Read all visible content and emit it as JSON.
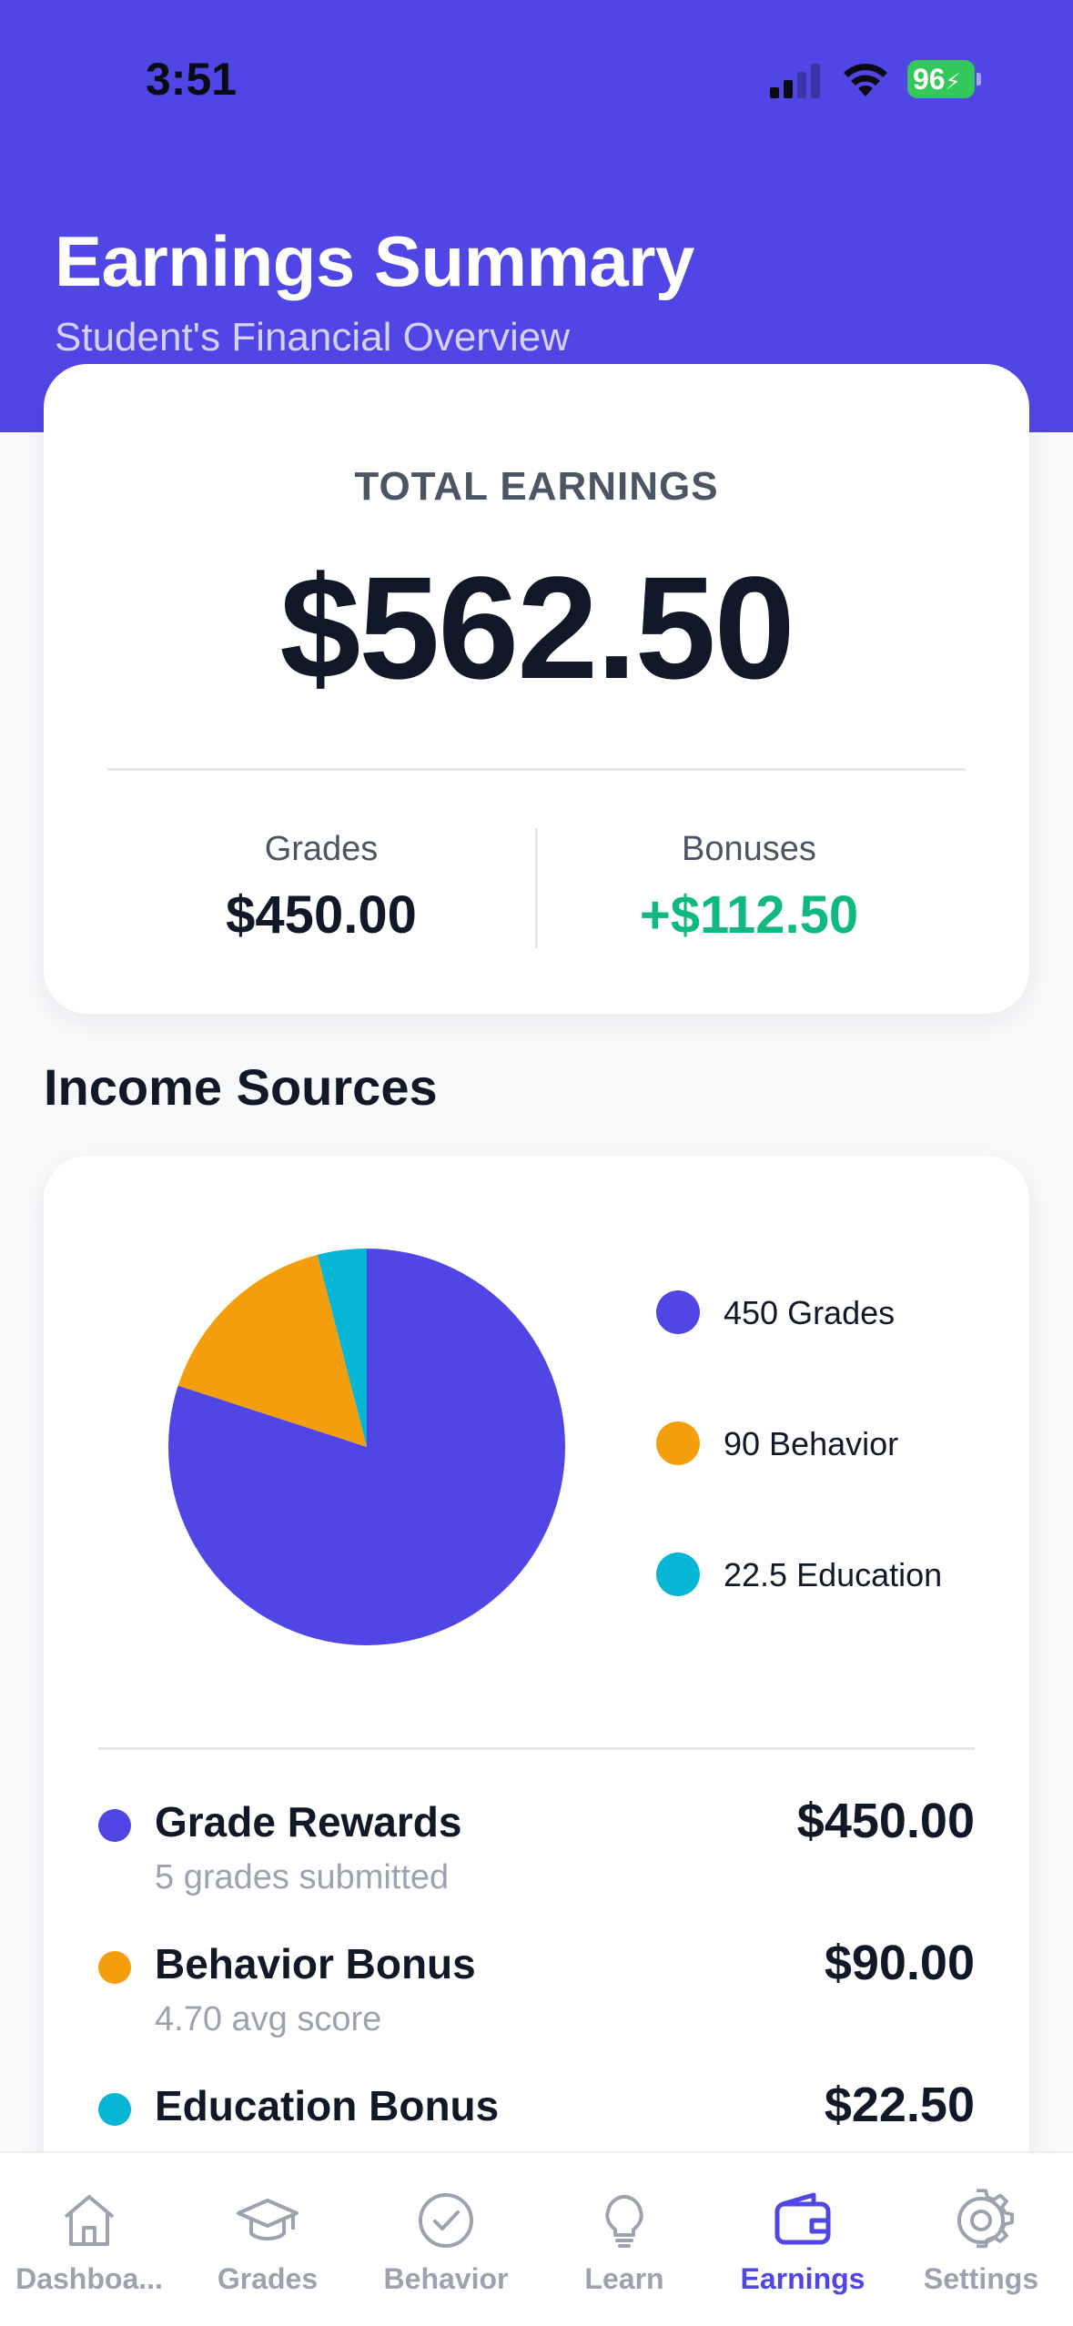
{
  "status_bar": {
    "time": "3:51",
    "battery": "96"
  },
  "header": {
    "title": "Earnings Summary",
    "subtitle": "Student's Financial Overview"
  },
  "total_card": {
    "label": "TOTAL EARNINGS",
    "value": "$562.50",
    "grades_label": "Grades",
    "grades_value": "$450.00",
    "bonuses_label": "Bonuses",
    "bonuses_value": "+$112.50"
  },
  "income_section": {
    "title": "Income Sources"
  },
  "chart_data": {
    "type": "pie",
    "slices": [
      {
        "label": "Grades",
        "value": 450,
        "legend": "450 Grades",
        "color": "#5046e5"
      },
      {
        "label": "Behavior",
        "value": 90,
        "legend": "90 Behavior",
        "color": "#f59e0b"
      },
      {
        "label": "Education",
        "value": 22.5,
        "legend": "22.5 Education",
        "color": "#06b6d4"
      }
    ],
    "legend_position": "right"
  },
  "sources": [
    {
      "name": "Grade Rewards",
      "sub": "5 grades submitted",
      "amount": "$450.00",
      "color": "#5046e5"
    },
    {
      "name": "Behavior Bonus",
      "sub": "4.70 avg score",
      "amount": "$90.00",
      "color": "#f59e0b"
    },
    {
      "name": "Education Bonus",
      "sub": "",
      "amount": "$22.50",
      "color": "#06b6d4"
    }
  ],
  "tabs": [
    {
      "label": "Dashboa...",
      "icon": "home-icon"
    },
    {
      "label": "Grades",
      "icon": "graduation-cap-icon"
    },
    {
      "label": "Behavior",
      "icon": "check-circle-icon"
    },
    {
      "label": "Learn",
      "icon": "lightbulb-icon"
    },
    {
      "label": "Earnings",
      "icon": "wallet-icon",
      "active": true
    },
    {
      "label": "Settings",
      "icon": "gear-icon"
    }
  ],
  "colors": {
    "accent": "#5046e5",
    "positive": "#10b981"
  }
}
